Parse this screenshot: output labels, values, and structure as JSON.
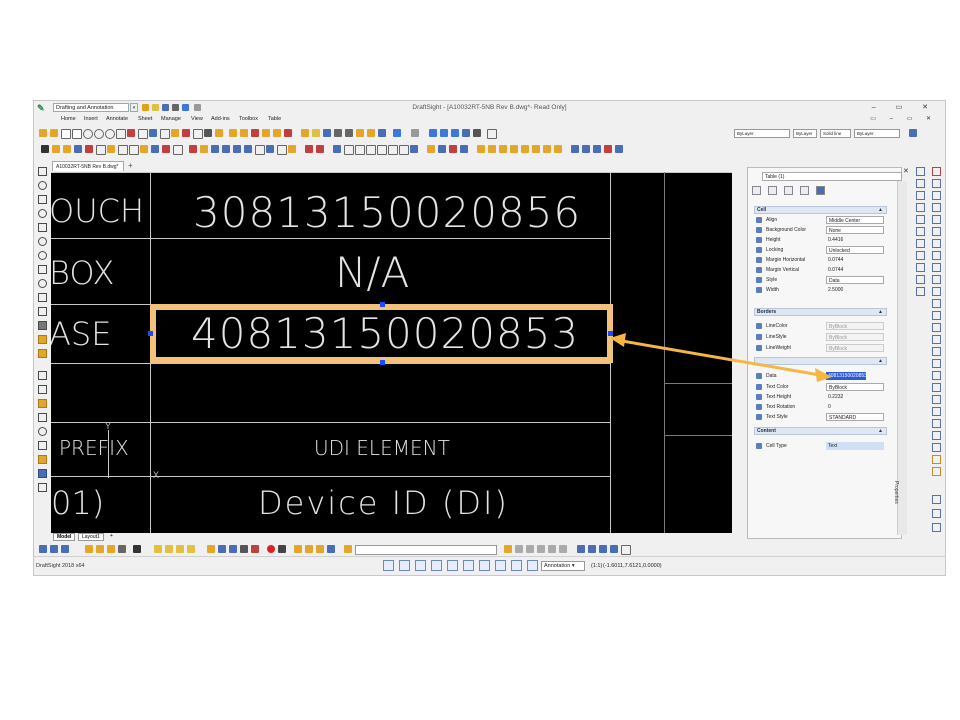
{
  "titlebar": {
    "workspace": "Drafting and Annotation",
    "title": "DraftSight - [A10032RT-5NB Rev B.dwg*- Read Only]",
    "window_controls": "– ▭ ✕"
  },
  "menu": [
    "Home",
    "Insert",
    "Annotate",
    "Sheet",
    "Manage",
    "View",
    "Add-ins",
    "Toolbox",
    "Table"
  ],
  "menu_right_controls": "▭ – ▭ ✕",
  "layer_bar": {
    "layer": "ByLayer",
    "linescale": "ByLayer",
    "linestyle": "Solid line",
    "lineweight": "ByLayer"
  },
  "document_tab": "A10032RT-5NB Rev B.dwg*",
  "canvas": {
    "row1_label": "OUCH",
    "row1_value": "30813150020856",
    "row2_label": "BOX",
    "row2_value": "N/A",
    "row3_label": "ASE",
    "row3_value": "40813150020853",
    "header_prefix": "PREFIX",
    "header_udi": "UDI ELEMENT",
    "row4_prefix": "01)",
    "row4_value": "Device ID (DI)",
    "ucs_y": "Y",
    "ucs_x": "X"
  },
  "model_tabs": [
    "Model",
    "Layout1"
  ],
  "model_tab_add": "+",
  "properties": {
    "selection": "Table (1)",
    "panel_tab": "Properties",
    "cell_section": "Cell",
    "cell_rows": [
      {
        "name": "Align",
        "value": "Middle Center"
      },
      {
        "name": "Background Color",
        "value": "None"
      },
      {
        "name": "Height",
        "value": "0.4416"
      },
      {
        "name": "Locking",
        "value": "Unlocked"
      },
      {
        "name": "Margin Horizontal",
        "value": "0.0744"
      },
      {
        "name": "Margin Vertical",
        "value": "0.0744"
      },
      {
        "name": "Style",
        "value": "Data"
      },
      {
        "name": "Width",
        "value": "2.5000"
      }
    ],
    "borders_section": "Borders",
    "border_rows": [
      {
        "name": "LineColor",
        "value": "ByBlock"
      },
      {
        "name": "LineStyle",
        "value": "ByBlock"
      },
      {
        "name": "LineWeight",
        "value": "ByBlock"
      }
    ],
    "text_rows": [
      {
        "name": "Data",
        "value": "40813150020853"
      },
      {
        "name": "Text Color",
        "value": "ByBlock"
      },
      {
        "name": "Text Height",
        "value": "0.2232"
      },
      {
        "name": "Text Rotation",
        "value": "0"
      },
      {
        "name": "Text Style",
        "value": "STANDARD"
      }
    ],
    "content_section": "Content",
    "content_rows": [
      {
        "name": "Cell Type",
        "value": "Text"
      }
    ]
  },
  "status": {
    "version": "DraftSight 2018 x64",
    "annotation": "Annotation",
    "scale": "(1:1)",
    "coords": "(-1.6011,7.6121,0.0000)"
  },
  "colors": {
    "selection_border": "#f2c27a",
    "arrow": "#f5b642",
    "grip": "#1a4bff",
    "canvas": "#000000"
  }
}
